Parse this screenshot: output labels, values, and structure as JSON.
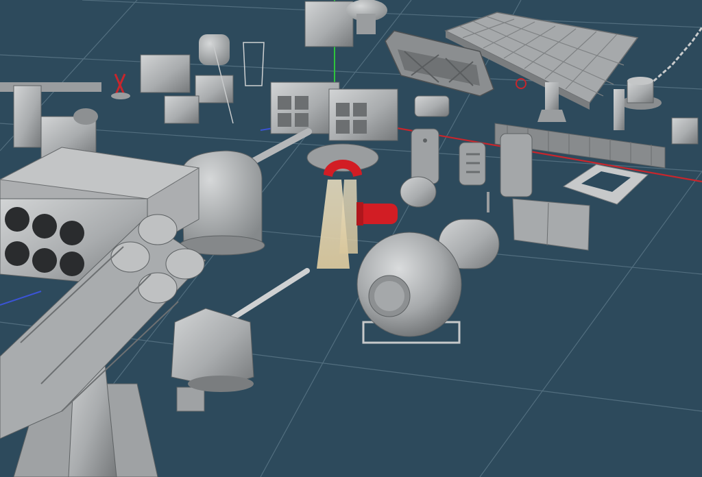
{
  "scene": {
    "background": "#2d4a5c",
    "grid_color": "#5f7b8b",
    "model_color": "#b4b6b8",
    "model_shade": "#8c8f92",
    "model_dark": "#5d6163",
    "highlight_color": "#d21d24",
    "beam_color": "#e6d5b0",
    "axes": {
      "x_axis_color": "#c8262c",
      "y_axis_color": "#2fc43c",
      "z_axis_color": "#3b54d6"
    },
    "objects": [
      "rocket-launcher",
      "vertical-launch-cells",
      "gun-turret-large",
      "gun-turret-small",
      "decompression-chamber",
      "radar-antenna",
      "deck-panel-grid",
      "anchor-chain-windlass",
      "searchlight-beams",
      "hatch-doors",
      "railing-panel",
      "deck-frame"
    ]
  }
}
